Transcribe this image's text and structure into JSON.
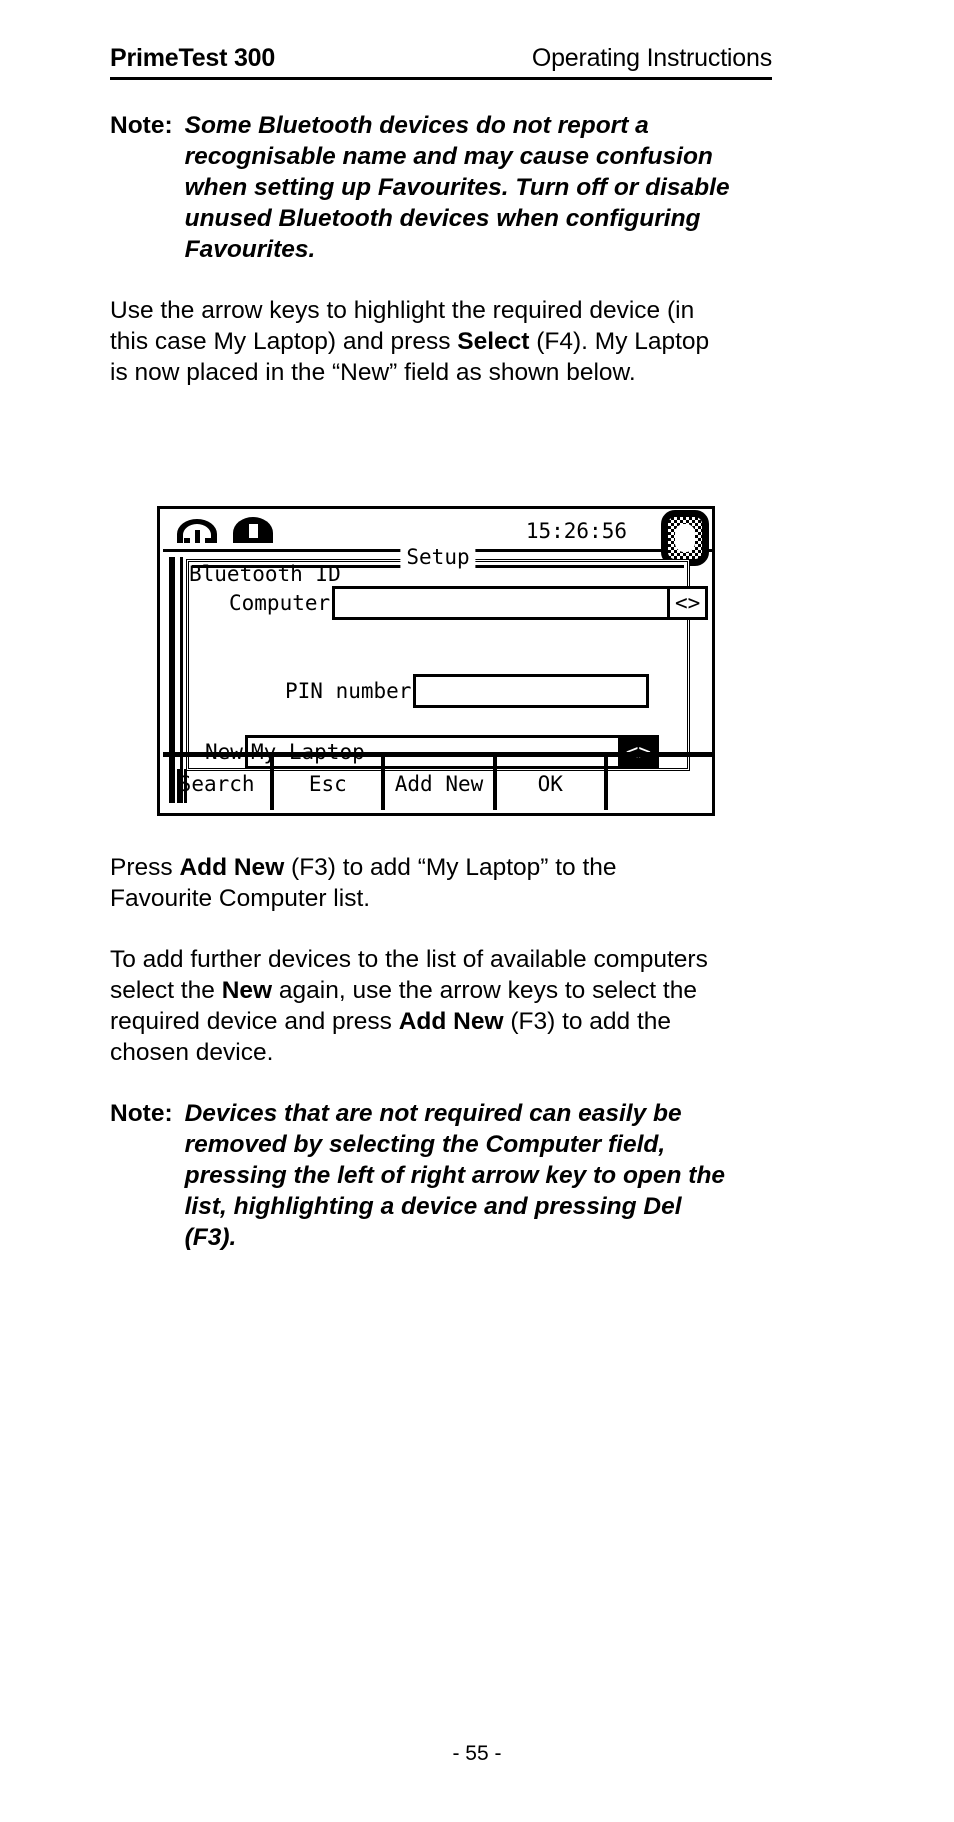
{
  "header": {
    "left_title": "PrimeTest 300",
    "right_title": "Operating Instructions"
  },
  "note1": {
    "label": "Note:",
    "lines": [
      "Some   Bluetooth   devices   do   not   report   a",
      "recognisable  name  and  may  cause  confusion",
      "when setting up Favourites. Turn off or disable",
      "unused   Bluetooth   devices   when   configuring",
      "Favourites."
    ]
  },
  "para1": {
    "lines": [
      "Use  the  arrow  keys  to  highlight  the  required  device  (in",
      "this case My Laptop) and press ",
      "Select",
      " (F4). My Laptop",
      "is now placed in the “New” field as shown below."
    ],
    "line1": "Use  the  arrow  keys  to  highlight  the  required  device  (in",
    "line2_a": "this case My Laptop) and press ",
    "line2_bold": "Select",
    "line2_b": " (F4). My Laptop",
    "line3": "is now placed in the “New” field as shown below."
  },
  "device": {
    "status": {
      "clock": "15:26:56",
      "icon_left": "mains-socket-outline-icon",
      "icon_right": "mains-socket-filled-icon",
      "battery": "battery-icon"
    },
    "panel_title": "Setup",
    "fields": {
      "computer_label": "Computer",
      "computer_value": "",
      "computer_spinner": "<>",
      "bluetooth_id_label": "Bluetooth ID",
      "pin_label": "PIN number",
      "pin_value": "",
      "new_label": "New",
      "new_value": "My Laptop",
      "new_spinner": "<>"
    },
    "softkeys": [
      "Search",
      "Esc",
      "Add New",
      "OK",
      ""
    ]
  },
  "para2": {
    "line1_a": "Press  ",
    "line1_bold": "Add  New",
    "line1_b": "  (F3)  to  add  “My  Laptop”  to  the",
    "line2": "Favourite Computer list."
  },
  "para3": {
    "line1": "To add further devices to the list of available computers",
    "line2_a": "select  the  ",
    "line2_bold": "New",
    "line2_b": "  again,  use  the  arrow  keys  to  select  the",
    "line3_a": "required  device  and  press  ",
    "line3_bold": "Add  New",
    "line3_b": "  (F3)  to  add  the",
    "line4": "chosen device."
  },
  "note2": {
    "label": "Note:",
    "lines": [
      "Devices   that   are   not   required   can   easily   be",
      "removed   by   selecting   the   Computer   field,",
      "pressing the left of right arrow key to open the",
      "list,   highlighting   a   device   and   pressing   Del",
      "(F3)."
    ]
  },
  "footer": {
    "page_number": "- 55 -"
  }
}
